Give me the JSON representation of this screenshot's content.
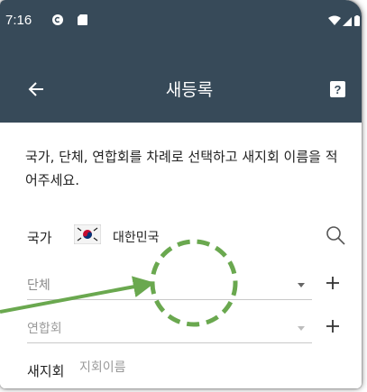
{
  "status_bar": {
    "time": "7:16",
    "icons": [
      "app-c-icon",
      "sd-card-icon",
      "wifi-icon",
      "signal-icon",
      "battery-icon"
    ]
  },
  "app_bar": {
    "title": "새등록",
    "back_icon": "back-arrow-icon",
    "help_icon": "help-icon"
  },
  "form": {
    "instructions": "국가, 단체, 연합회를 차례로 선택하고 새지회 이름을 적어주세요.",
    "country_label": "국가",
    "country_value": "대한민국",
    "country_flag": "korea-flag-icon",
    "group_placeholder": "단체",
    "union_placeholder": "연합회",
    "branch_label": "새지회",
    "branch_placeholder": "지회이름",
    "branch_value": ""
  },
  "colors": {
    "app_bar": "#374a59",
    "annotation": "#6aa84f"
  }
}
